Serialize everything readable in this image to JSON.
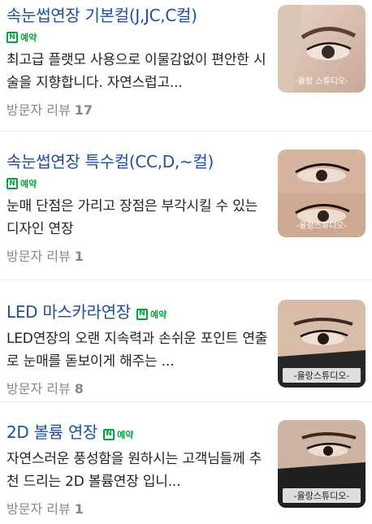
{
  "items": [
    {
      "title": "속눈썹연장 기본컬(J,JC,C컬)",
      "badge": "예약",
      "badge_icon": "N",
      "description": "최고급 플랫모 사용으로 이물감없이 편안한 시술을 지향합니다. 자연스럽고...",
      "review_label": "방문자 리뷰",
      "review_count": "17",
      "thumb_caption": "-율랑 스튜디오-"
    },
    {
      "title": "속눈썹연장 특수컬(CC,D,~컬)",
      "badge": "예약",
      "badge_icon": "N",
      "description": "눈매 단점은 가리고 장점은 부각시킬 수 있는 디자인 연장",
      "review_label": "방문자 리뷰",
      "review_count": "1",
      "thumb_caption": "-율랑스튜디오-"
    },
    {
      "title": "LED 마스카라연장",
      "badge": "예약",
      "badge_icon": "N",
      "description": "LED연장의 오랜 지속력과 손쉬운 포인트 연출로 눈매를 돋보이게 해주는 ...",
      "review_label": "방문자 리뷰",
      "review_count": "8",
      "thumb_caption": "-율랑스튜디오-"
    },
    {
      "title": "2D 볼륨 연장",
      "badge": "예약",
      "badge_icon": "N",
      "description": "자연스러운 풍성함을 원하시는 고객님들께 추천 드리는 2D 볼륨연장 입니...",
      "review_label": "방문자 리뷰",
      "review_count": "1",
      "thumb_caption": "-율랑스튜디오-"
    }
  ],
  "colors": {
    "title": "#1f4e9c",
    "badge": "#00a33e",
    "review": "#888888",
    "divider": "#ebebeb"
  }
}
